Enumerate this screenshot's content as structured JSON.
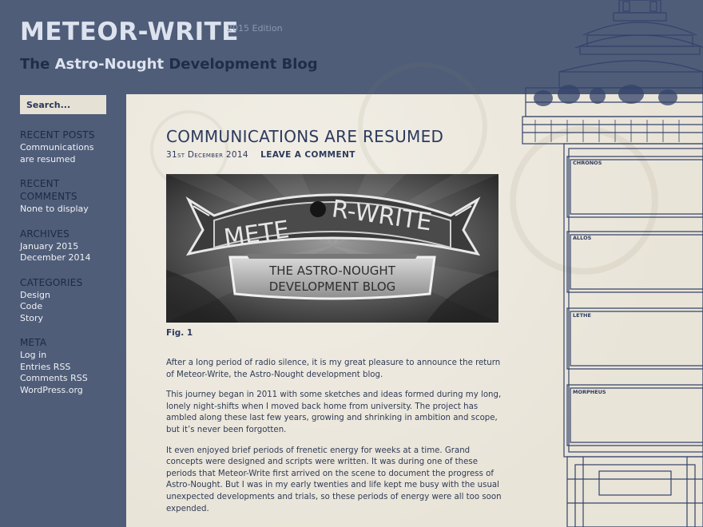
{
  "site": {
    "title": "METEOR-WRITE",
    "edition": "2015 Edition",
    "tagline_prefix": "The ",
    "tagline_highlight": "Astro-Nought",
    "tagline_suffix": " Development Blog"
  },
  "search": {
    "placeholder": "Search..."
  },
  "sidebar": {
    "recent_posts": {
      "heading": "Recent Posts",
      "items": [
        "Communications",
        "are resumed"
      ]
    },
    "recent_comments": {
      "heading_line1": "Recent",
      "heading_line2": "Comments",
      "empty": "None to display"
    },
    "archives": {
      "heading": "Archives",
      "items": [
        "January 2015",
        "December 2014"
      ]
    },
    "categories": {
      "heading": "Categories",
      "items": [
        "Design",
        "Code",
        "Story"
      ]
    },
    "meta": {
      "heading": "Meta",
      "items": [
        "Log in",
        "Entries RSS",
        "Comments RSS",
        "WordPress.org"
      ]
    }
  },
  "post": {
    "title": "COMMUNICATIONS ARE RESUMED",
    "date": "31st December 2014",
    "leave_comment": "LEAVE A COMMENT",
    "image_text": {
      "logo_left": "METE",
      "logo_right": "R-WRITE",
      "line1": "THE ASTRO-NOUGHT",
      "line2": "DEVELOPMENT BLOG"
    },
    "figure_caption": "Fig. 1",
    "paragraphs": [
      "After a long period of radio silence, it is my great pleasure to announce the return of Meteor-Write, the Astro-Nought development blog.",
      "This journey began in 2011 with some sketches and ideas formed during my long, lonely night-shifts when I moved back home from university. The project has ambled along these last few years, growing and shrinking in ambition and scope, but it’s never been forgotten.",
      "It even enjoyed brief periods of frenetic energy for weeks at a time. Grand concepts were designed and scripts were written. It was during one of these periods that Meteor-Write first arrived on the scene to document the progress of Astro-Nought. But I was in my early twenties and life kept me busy with the usual unexpected developments and trials, so these periods of energy were all too soon expended."
    ]
  },
  "blueprint": {
    "labels": [
      "CHRONOS",
      "ALLOS",
      "LETHE",
      "MORPHEUS"
    ]
  },
  "colors": {
    "background": "#4f5d79",
    "paper": "#ede9df",
    "navy_text": "#2c3a5c",
    "light_text": "#dde3ee"
  }
}
